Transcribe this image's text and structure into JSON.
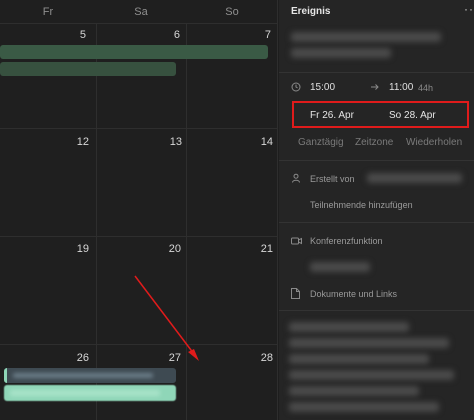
{
  "calendar": {
    "weekday_headers": [
      "Fr",
      "Sa",
      "So"
    ],
    "week_rows": [
      [
        "5",
        "6",
        "7"
      ],
      [
        "12",
        "13",
        "14"
      ],
      [
        "19",
        "20",
        "21"
      ],
      [
        "26",
        "27",
        "28"
      ]
    ]
  },
  "panel": {
    "title": "Ereignis",
    "more_label": "···",
    "start_time": "15:00",
    "end_time": "11:00",
    "duration": "44h",
    "start_date": "Fr 26. Apr",
    "end_date": "So 28. Apr",
    "options": [
      "Ganztägig",
      "Zeitzone",
      "Wiederholen"
    ],
    "created_by_label": "Erstellt von",
    "add_participants": "Teilnehmende hinzufügen",
    "conference_label": "Konferenzfunktion",
    "documents_label": "Dokumente und Links"
  },
  "colors": {
    "highlight_box": "#e01b1b",
    "event_green": "#3a5a45",
    "event_mint": "#8fd6b8"
  },
  "icons": {
    "clock": "clock-icon",
    "arrow_right": "arrow-right-icon",
    "person": "person-icon",
    "video": "video-icon",
    "document": "document-icon"
  }
}
